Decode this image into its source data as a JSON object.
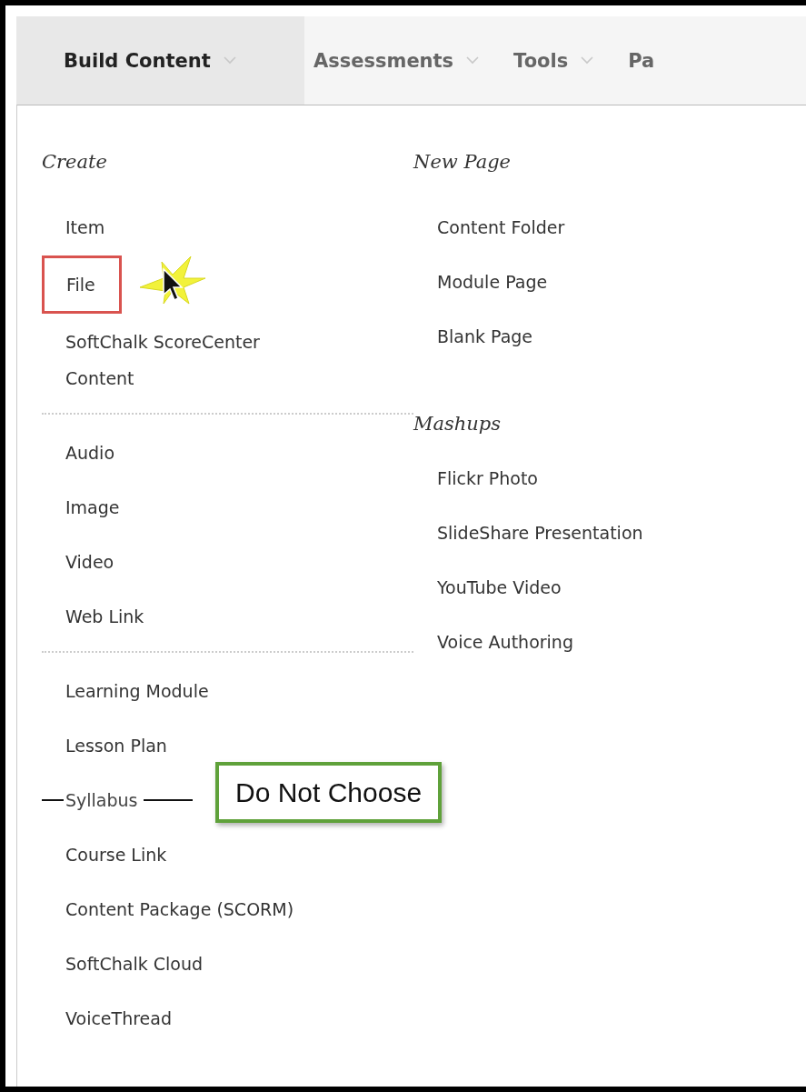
{
  "tabs": [
    {
      "label": "Build Content",
      "selected": true,
      "chevron": true
    },
    {
      "label": "Assessments",
      "selected": false,
      "chevron": true
    },
    {
      "label": "Tools",
      "selected": false,
      "chevron": true
    },
    {
      "label": "Pa",
      "selected": false,
      "chevron": false
    }
  ],
  "columns": [
    {
      "sections": [
        {
          "heading": "Create",
          "groups": [
            [
              {
                "label": "Item",
                "kind": "plain"
              },
              {
                "label": "File",
                "kind": "boxed"
              },
              {
                "label": "SoftChalk ScoreCenter Content",
                "kind": "plain"
              }
            ],
            [
              {
                "label": "Audio",
                "kind": "plain"
              },
              {
                "label": "Image",
                "kind": "plain"
              },
              {
                "label": "Video",
                "kind": "plain"
              },
              {
                "label": "Web Link",
                "kind": "plain"
              }
            ],
            [
              {
                "label": "Learning Module",
                "kind": "plain"
              },
              {
                "label": "Lesson Plan",
                "kind": "plain"
              },
              {
                "label": "Syllabus",
                "kind": "struck",
                "note": "Do Not Choose"
              },
              {
                "label": "Course Link",
                "kind": "plain"
              },
              {
                "label": "Content Package (SCORM)",
                "kind": "plain"
              },
              {
                "label": "SoftChalk Cloud",
                "kind": "plain"
              },
              {
                "label": "VoiceThread",
                "kind": "plain"
              }
            ]
          ]
        }
      ]
    },
    {
      "sections": [
        {
          "heading": "New Page",
          "groups": [
            [
              {
                "label": "Content Folder",
                "kind": "plain"
              },
              {
                "label": "Module Page",
                "kind": "plain"
              },
              {
                "label": "Blank Page",
                "kind": "plain"
              }
            ]
          ]
        },
        {
          "heading": "Mashups",
          "groups": [
            [
              {
                "label": "Flickr Photo",
                "kind": "plain"
              },
              {
                "label": "SlideShare Presentation",
                "kind": "plain"
              },
              {
                "label": "YouTube Video",
                "kind": "plain"
              },
              {
                "label": "Voice Authoring",
                "kind": "plain"
              }
            ]
          ]
        }
      ]
    }
  ]
}
